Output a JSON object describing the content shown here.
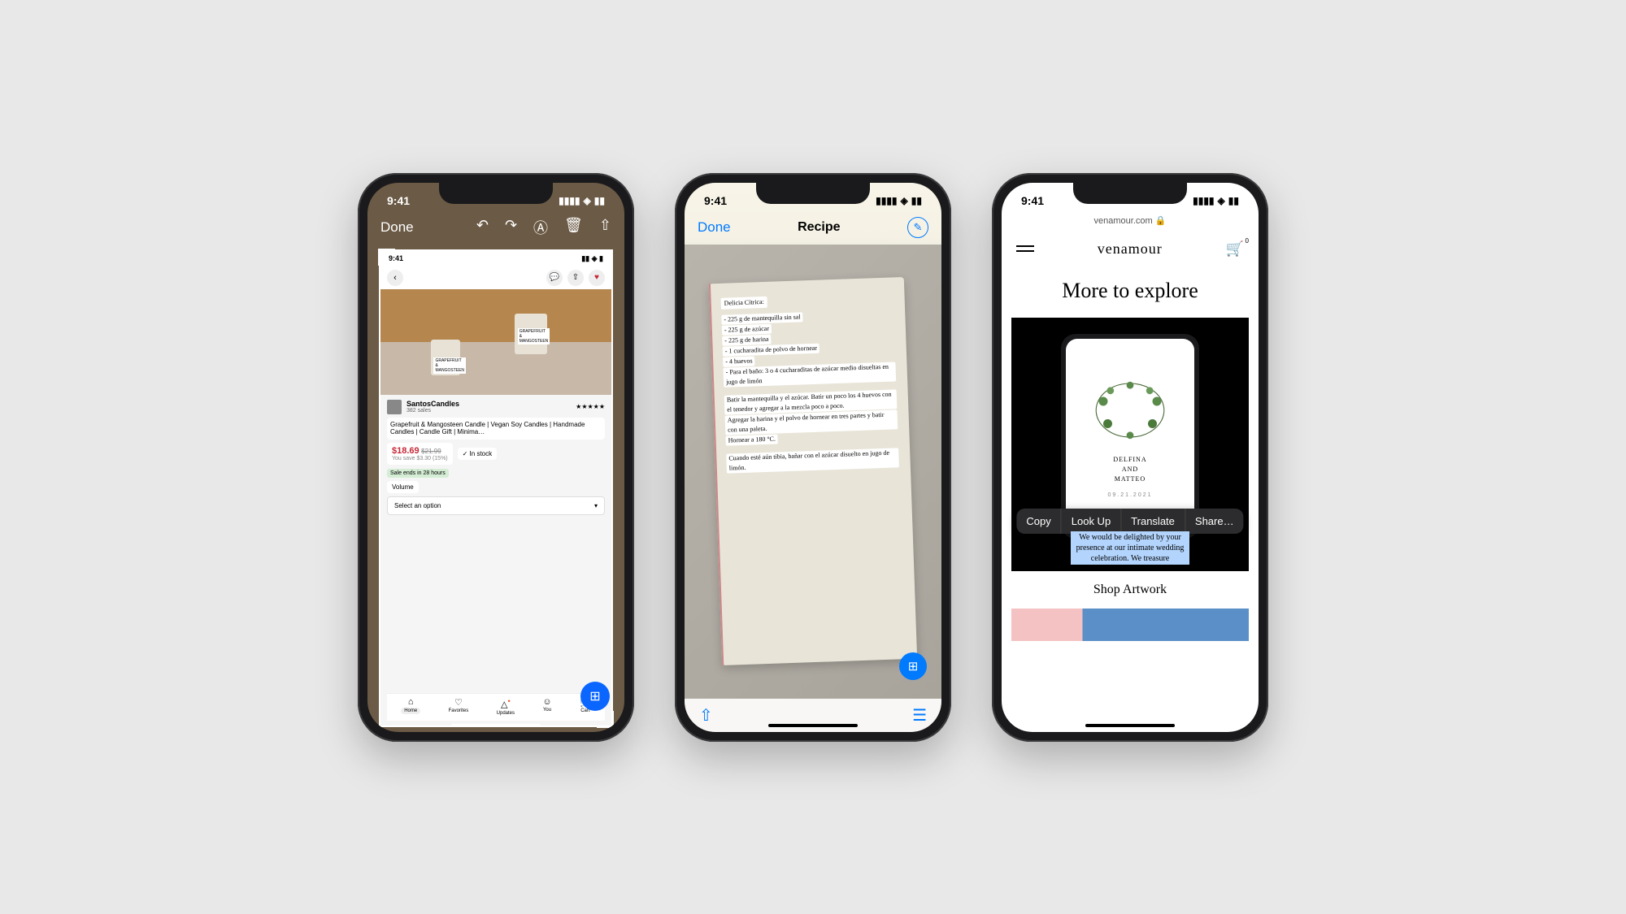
{
  "status_time": "9:41",
  "phone1": {
    "toolbar": {
      "done": "Done"
    },
    "inner_status_time": "9:41",
    "product": {
      "seller_name": "SantosCandles",
      "seller_sales": "382 sales",
      "stars": "★★★★★",
      "title": "Grapefruit & Mangosteen Candle | Vegan Soy Candles | Handmade Candles | Candle Gift | Minima…",
      "candle_label": "GRAPEFRUIT & MANGOSTEEN",
      "price_now": "$18.69",
      "price_was": "$21.99",
      "save_text": "You save $3.30 (15%)",
      "sale_ends": "Sale ends in 28 hours",
      "in_stock": "✓ In stock",
      "volume_chip": "Volume",
      "select_label": "Select an option"
    },
    "tabs": {
      "home": "Home",
      "favorites": "Favorites",
      "updates": "Updates",
      "you": "You",
      "cart": "Cart"
    }
  },
  "phone2": {
    "toolbar": {
      "done": "Done",
      "title": "Recipe"
    },
    "recipe_title": "Delicia Cítrica:",
    "ingredients": [
      "- 225 g de mantequilla sin sal",
      "- 225 g de azúcar",
      "- 225 g de harina",
      "- 1 cucharadita de polvo de hornear",
      "- 4 huevos",
      "- Para el baño: 3 o 4 cucharaditas de azúcar medio disueltas en jugo de limón"
    ],
    "steps": [
      "Batir la mantequilla y el azúcar. Batir un poco los 4 huevos con el tenedor y agregar a la mezcla poco a poco.",
      "Agregar la harina y el polvo de hornear en tres partes y batir con una paleta.",
      "Hornear a 180 °C."
    ],
    "finish": "Cuando esté aún tibia, bañar con el azúcar disuelto en jugo de limón."
  },
  "phone3": {
    "url": "venamour.com",
    "brand": "venamour",
    "cart_count": "0",
    "section_title": "More to explore",
    "invite_names": "DELFINA\nAND\nMATTEO",
    "invite_date": "09.21.2021",
    "context_menu": [
      "Copy",
      "Look Up",
      "Translate",
      "Share…"
    ],
    "selected_text": "We would be delighted by your presence at our intimate wedding celebration. We treasure",
    "shop_label": "Shop Artwork"
  }
}
